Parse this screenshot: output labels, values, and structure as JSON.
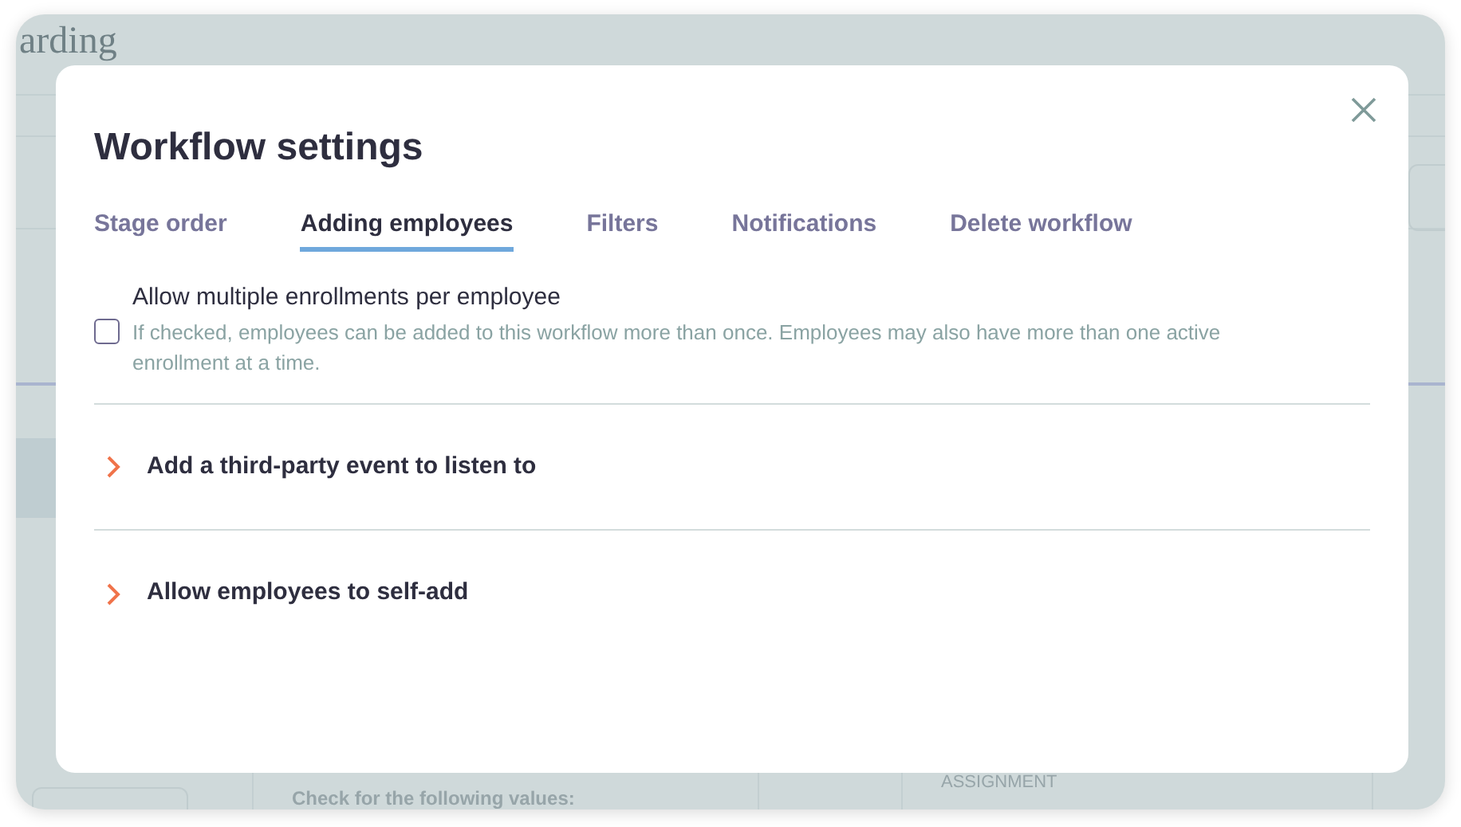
{
  "background": {
    "page_title": "arding",
    "filter_card": {
      "text": "Check for the following values:"
    },
    "assignment_card": {
      "label": "ASSIGNMENT"
    }
  },
  "modal": {
    "title": "Workflow settings",
    "tabs": [
      {
        "label": "Stage order",
        "selected": false
      },
      {
        "label": "Adding employees",
        "selected": true
      },
      {
        "label": "Filters",
        "selected": false
      },
      {
        "label": "Notifications",
        "selected": false
      },
      {
        "label": "Delete workflow",
        "selected": false
      }
    ],
    "options": [
      {
        "kind": "checkbox",
        "label": "Allow multiple enrollments per employee",
        "help": "If checked, employees can be added to this workflow more than once. Employees may also have more than one active enrollment at a time.",
        "checked": false
      }
    ],
    "sections": [
      {
        "label": "Add a third-party event to listen to",
        "expanded": false
      },
      {
        "label": "Allow employees to self-add",
        "expanded": false
      }
    ]
  }
}
